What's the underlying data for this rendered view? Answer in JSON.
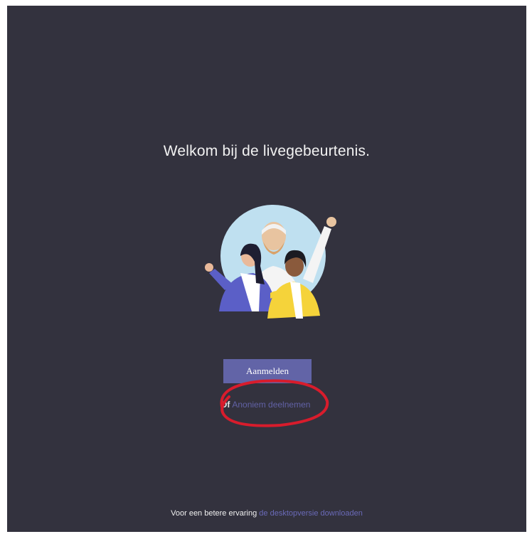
{
  "welcome": {
    "title": "Welkom bij de livegebeurtenis."
  },
  "actions": {
    "signin_label": "Aanmelden",
    "anonymous_prefix": "Of",
    "anonymous_link": "Anoniem deelnemen"
  },
  "footer": {
    "text": "Voor een betere ervaring",
    "link": "de desktopversie downloaden"
  },
  "colors": {
    "background": "#33323e",
    "accent": "#6264a7",
    "annotation_circle": "#d81c2c"
  },
  "icons": {
    "illustration": "people-waving-illustration"
  }
}
